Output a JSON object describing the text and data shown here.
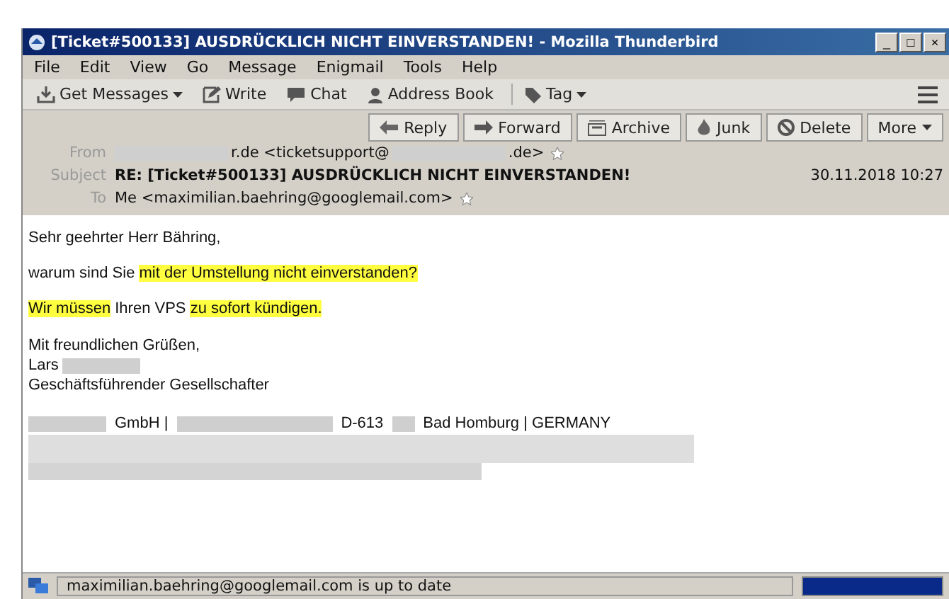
{
  "window": {
    "title": "[Ticket#500133] AUSDRÜCKLICH NICHT EINVERSTANDEN! - Mozilla Thunderbird",
    "controls": [
      "_",
      "□",
      "×"
    ]
  },
  "menu": [
    "File",
    "Edit",
    "View",
    "Go",
    "Message",
    "Enigmail",
    "Tools",
    "Help"
  ],
  "toolbar": [
    {
      "kind": "download",
      "label": "Get Messages",
      "dropdown": true
    },
    {
      "kind": "pencil",
      "label": "Write",
      "dropdown": false
    },
    {
      "kind": "chat",
      "label": "Chat",
      "dropdown": false
    },
    {
      "kind": "person",
      "label": "Address Book",
      "dropdown": false
    },
    {
      "kind": "tag",
      "label": "Tag",
      "dropdown": true
    }
  ],
  "actions": [
    {
      "kind": "reply",
      "label": "Reply",
      "dropdown": false
    },
    {
      "kind": "forward",
      "label": "Forward",
      "dropdown": false
    },
    {
      "kind": "archive",
      "label": "Archive",
      "dropdown": false
    },
    {
      "kind": "junk",
      "label": "Junk",
      "dropdown": false
    },
    {
      "kind": "delete",
      "label": "Delete",
      "dropdown": false
    },
    {
      "kind": "none",
      "label": "More",
      "dropdown": true
    }
  ],
  "header": {
    "from_label": "From",
    "from_parts": [
      "r.de <ticketsupport@",
      ".de>"
    ],
    "subject_label": "Subject",
    "subject": "RE: [Ticket#500133] AUSDRÜCKLICH NICHT EINVERSTANDEN!",
    "date": "30.11.2018 10:27",
    "to_label": "To",
    "to": "Me <maximilian.baehring@googlemail.com>"
  },
  "body": {
    "paragraphs": [
      [
        {
          "text": "Sehr geehrter Herr Bähring,",
          "highlighted": false
        }
      ],
      [
        {
          "text": "warum sind Sie ",
          "highlighted": false
        },
        {
          "text": "mit der Umstellung nicht einverstanden?",
          "highlighted": true
        }
      ],
      [
        {
          "text": "Wir müssen",
          "highlighted": true
        },
        {
          "text": " Ihren VPS ",
          "highlighted": false
        },
        {
          "text": "zu sofort kündigen.",
          "highlighted": true
        }
      ]
    ],
    "closing": "Mit freundlichen Grüßen,",
    "name": "Lars",
    "role": "Geschäftsführender Gesellschafter",
    "company": [
      "GmbH |",
      "D-613",
      "Bad Homburg | GERMANY"
    ]
  },
  "status_bar": {
    "text": "maximilian.baehring@googlemail.com is up to date",
    "level": 1
  }
}
